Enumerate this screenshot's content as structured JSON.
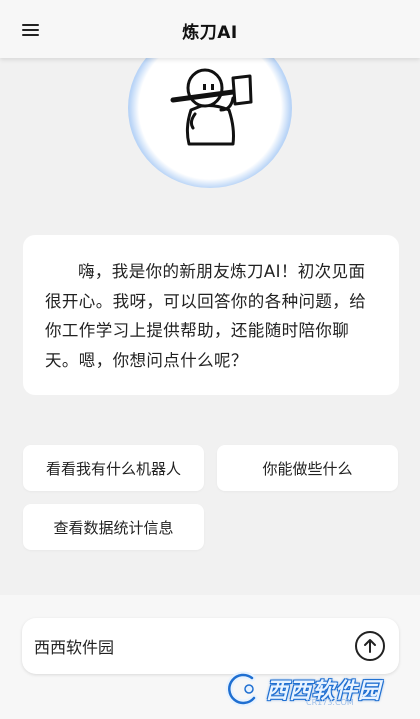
{
  "header": {
    "title": "炼刀AI",
    "menu_icon": "hamburger-menu-icon"
  },
  "avatar": {
    "icon": "stick-figure-with-hammer-icon",
    "glow_color": "#8fbaf2"
  },
  "greeting": {
    "text": "嗨，我是你的新朋友炼刀AI！初次见面很开心。我呀，可以回答你的各种问题，给你工作学习上提供帮助，还能随时陪你聊天。嗯，你想问点什么呢？"
  },
  "suggestions": [
    {
      "label": "看看我有什么机器人"
    },
    {
      "label": "你能做些什么"
    },
    {
      "label": "查看数据统计信息"
    }
  ],
  "input": {
    "value": "西西软件园",
    "send_icon": "arrow-up-circle-icon"
  },
  "watermark": {
    "text": "西西软件园",
    "sub": "CR173.COM"
  }
}
